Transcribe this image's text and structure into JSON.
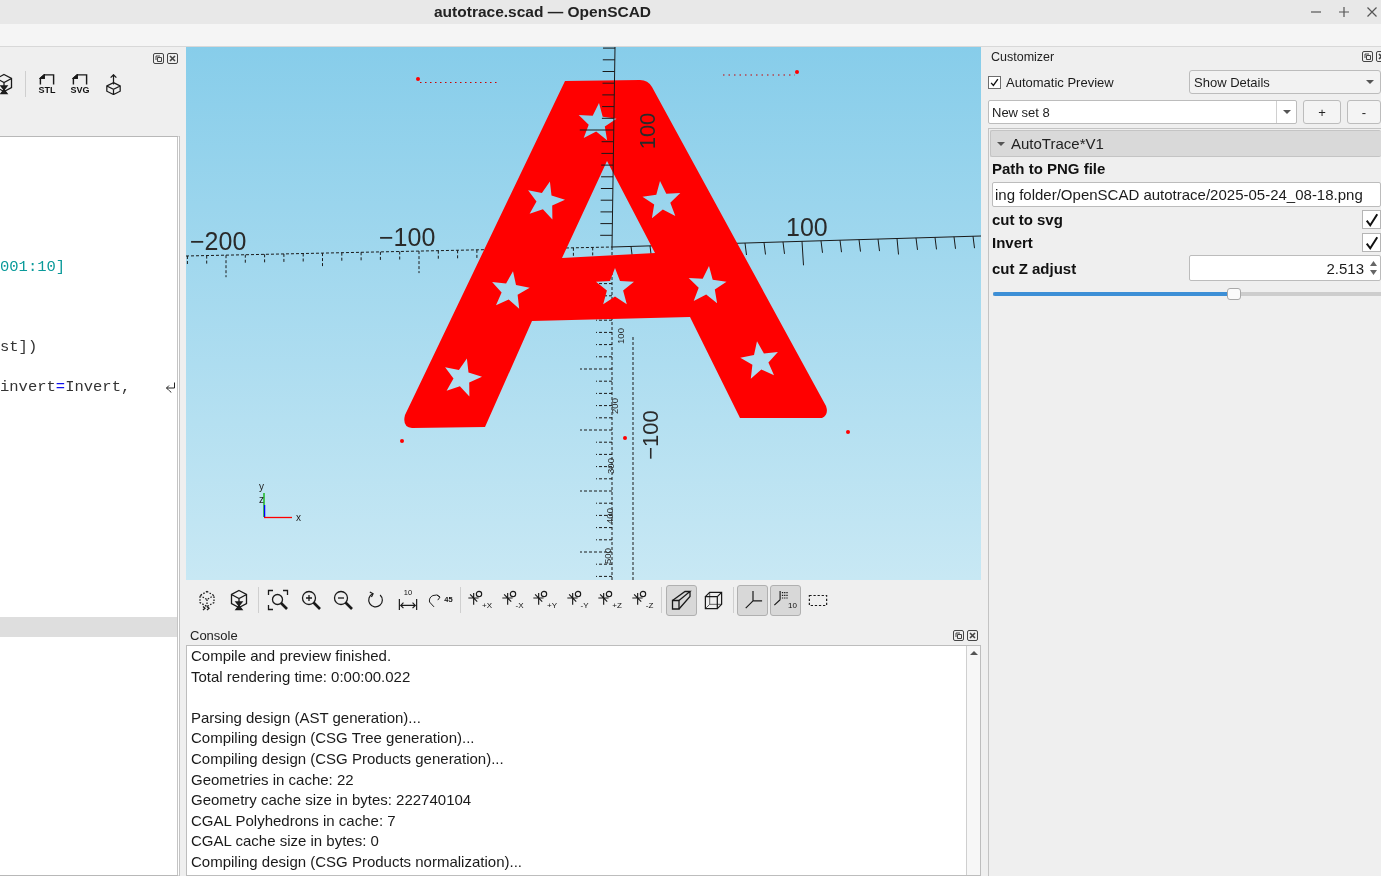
{
  "window": {
    "title": "autotrace.scad — OpenSCAD"
  },
  "editor": {
    "toolbar": [
      {
        "kind": "render"
      },
      {
        "kind": "export",
        "caption": "STL"
      },
      {
        "kind": "export",
        "caption": "SVG"
      },
      {
        "kind": "send"
      }
    ],
    "lines": [
      {
        "kind": "blank",
        "current": false,
        "wrapped": false
      },
      {
        "kind": "blank",
        "current": false,
        "wrapped": false
      },
      {
        "kind": "blank",
        "current": false,
        "wrapped": false
      },
      {
        "kind": "blank",
        "current": false,
        "wrapped": false
      },
      {
        "kind": "blank",
        "current": false,
        "wrapped": false
      },
      {
        "kind": "blank",
        "current": false,
        "wrapped": false
      },
      {
        "kind": "code",
        "current": false,
        "wrapped": false,
        "tokens": [
          {
            "text": "001:10]",
            "kind": "number"
          }
        ]
      },
      {
        "kind": "blank",
        "current": false,
        "wrapped": false
      },
      {
        "kind": "blank",
        "current": false,
        "wrapped": false
      },
      {
        "kind": "blank",
        "current": false,
        "wrapped": false
      },
      {
        "kind": "code",
        "current": false,
        "wrapped": false,
        "tokens": [
          {
            "text": "st])",
            "kind": "plain"
          }
        ]
      },
      {
        "kind": "blank",
        "current": false,
        "wrapped": false
      },
      {
        "kind": "code",
        "current": false,
        "wrapped": true,
        "tokens": [
          {
            "text": "invert",
            "kind": "plain"
          },
          {
            "text": "=",
            "kind": "operator"
          },
          {
            "text": "Invert,",
            "kind": "plain"
          }
        ]
      },
      {
        "kind": "blank",
        "current": false,
        "wrapped": false
      },
      {
        "kind": "blank",
        "current": false,
        "wrapped": false
      },
      {
        "kind": "blank",
        "current": false,
        "wrapped": false
      },
      {
        "kind": "blank",
        "current": false,
        "wrapped": false
      },
      {
        "kind": "blank",
        "current": false,
        "wrapped": false
      },
      {
        "kind": "blank",
        "current": false,
        "wrapped": false
      },
      {
        "kind": "blank",
        "current": false,
        "wrapped": false
      },
      {
        "kind": "blank",
        "current": false,
        "wrapped": false
      },
      {
        "kind": "blank",
        "current": false,
        "wrapped": false
      },
      {
        "kind": "blank",
        "current": false,
        "wrapped": false
      },
      {
        "kind": "blank",
        "current": false,
        "wrapped": false
      },
      {
        "kind": "blank",
        "current": true,
        "wrapped": false
      }
    ]
  },
  "viewport": {
    "axis_labels": [
      {
        "text": "−200",
        "kind": "horizontal"
      },
      {
        "text": "−100",
        "kind": "horizontal"
      },
      {
        "text": "100",
        "kind": "horizontal"
      },
      {
        "text": "100",
        "kind": "vertical"
      },
      {
        "text": "−100",
        "kind": "vertical"
      },
      {
        "text": "100",
        "kind": "small"
      },
      {
        "text": "200",
        "kind": "small"
      },
      {
        "text": "300",
        "kind": "small"
      },
      {
        "text": "400",
        "kind": "small"
      },
      {
        "text": "500",
        "kind": "small"
      }
    ],
    "orientation_labels": [
      "y",
      "z",
      "x"
    ]
  },
  "view_toolbar": {
    "groups": [
      [
        {
          "kind": "preview",
          "on": false
        },
        {
          "kind": "render",
          "on": false
        }
      ],
      [
        {
          "kind": "view-all",
          "on": false
        },
        {
          "kind": "zoom-in",
          "on": false
        },
        {
          "kind": "zoom-out",
          "on": false
        },
        {
          "kind": "reset-view",
          "on": false
        },
        {
          "kind": "measure-distance",
          "caption": "10",
          "on": false
        },
        {
          "kind": "measure-angle",
          "caption": "45",
          "on": false
        }
      ],
      [
        {
          "kind": "view-axis",
          "caption": "+X",
          "on": false
        },
        {
          "kind": "view-axis",
          "caption": "-X",
          "on": false
        },
        {
          "kind": "view-axis",
          "caption": "+Y",
          "on": false
        },
        {
          "kind": "view-axis",
          "caption": "-Y",
          "on": false
        },
        {
          "kind": "view-axis",
          "caption": "+Z",
          "on": false
        },
        {
          "kind": "view-axis",
          "caption": "-Z",
          "on": false
        }
      ],
      [
        {
          "kind": "perspective",
          "on": true
        },
        {
          "kind": "orthogonal",
          "on": false
        }
      ],
      [
        {
          "kind": "axes",
          "on": true
        },
        {
          "kind": "scale-markers",
          "caption": "10",
          "on": true
        },
        {
          "kind": "edges",
          "on": false
        }
      ]
    ]
  },
  "console": {
    "title": "Console",
    "blocks": [
      [
        "Compile and preview finished.",
        "Total rendering time: 0:00:00.022"
      ],
      [
        "Parsing design (AST generation)...",
        "Compiling design (CSG Tree generation)...",
        "Compiling design (CSG Products generation)...",
        "Geometries in cache: 22",
        "Geometry cache size in bytes: 222740104",
        "CGAL Polyhedrons in cache: 7",
        "CGAL cache size in bytes: 0",
        "Compiling design (CSG Products normalization)..."
      ]
    ]
  },
  "customizer": {
    "title": "Customizer",
    "auto_preview": {
      "label": "Automatic Preview",
      "checked": true
    },
    "detail_mode": {
      "value": "Show Details"
    },
    "preset": {
      "value": "New set 8"
    },
    "preset_buttons": [
      "+",
      "-"
    ],
    "groups": [
      {
        "title": "AutoTrace*V1",
        "expanded": true,
        "params": [
          {
            "kind": "text",
            "label": "Path to PNG file",
            "value": "ing folder/OpenSCAD autotrace/2025-05-24_08-18.png"
          },
          {
            "kind": "checkbox",
            "label": "cut to svg",
            "checked": true
          },
          {
            "kind": "checkbox",
            "label": "Invert",
            "checked": true
          },
          {
            "kind": "number",
            "label": "cut Z adjust",
            "value": "2.513",
            "slider": {
              "level": 0.62
            }
          }
        ]
      }
    ]
  }
}
